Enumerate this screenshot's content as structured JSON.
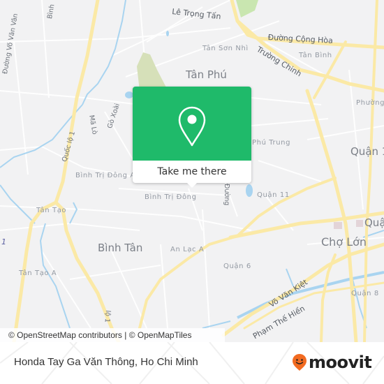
{
  "map": {
    "colors": {
      "background": "#f2f2f3",
      "major_road": "#fbe9a6",
      "water": "#a9d4f0",
      "park": "#d6e0b9",
      "green_area": "#c9e6b0",
      "building_block": "#e3d4d8"
    },
    "labels": {
      "districts": [
        {
          "id": "tan-phu",
          "text": "Tân Phú"
        },
        {
          "id": "binh-tan",
          "text": "Bình Tân"
        },
        {
          "id": "cho-lon",
          "text": "Chợ Lớn"
        },
        {
          "id": "quan-10-partial",
          "text": "Quận 1"
        },
        {
          "id": "quan-5-partial",
          "text": "Quận"
        }
      ],
      "wards": [
        {
          "id": "tan-son-nhi",
          "text": "Tân Sơn Nhì"
        },
        {
          "id": "tan-binh",
          "text": "Tân Bình"
        },
        {
          "id": "phuong-partial",
          "text": "Phường"
        },
        {
          "id": "phu-trung",
          "text": "Phú Trung"
        },
        {
          "id": "quan-11",
          "text": "Quận 11"
        },
        {
          "id": "binh-tri-dong-a",
          "text": "Bình Trị Đông A"
        },
        {
          "id": "binh-tri-dong",
          "text": "Bình Trị Đông"
        },
        {
          "id": "tan-tao",
          "text": "Tân Tạo"
        },
        {
          "id": "tan-tao-a",
          "text": "Tân Tạo A"
        },
        {
          "id": "an-lac-a",
          "text": "An Lạc A"
        },
        {
          "id": "quan-6",
          "text": "Quận 6"
        },
        {
          "id": "quan-8",
          "text": "Quận 8"
        }
      ],
      "streets": [
        {
          "id": "le-trong-tan",
          "text": "Lê Trọng Tấn"
        },
        {
          "id": "duong-cong-hoa",
          "text": "Đường Cộng Hòa"
        },
        {
          "id": "truong-chinh",
          "text": "Trường Chinh"
        },
        {
          "id": "quoc-lo-1",
          "text": "Quốc lộ 1"
        },
        {
          "id": "quoc-lo-1-south",
          "text": "lộ 1"
        },
        {
          "id": "ma-lo",
          "text": "Mã Lò"
        },
        {
          "id": "go-xoai",
          "text": "Gò Xoài"
        },
        {
          "id": "duong-vo-van-van",
          "text": "Đường Võ Văn Vân"
        },
        {
          "id": "binh-partial",
          "text": "Bình"
        },
        {
          "id": "duong-partial",
          "text": "Đường"
        },
        {
          "id": "vo-van-kiet",
          "text": "Võ Văn Kiệt"
        },
        {
          "id": "pham-the-hien",
          "text": "Phạm Thế Hiển"
        }
      ],
      "route_marker": "1"
    },
    "attribution": "© OpenStreetMap contributors | © OpenMapTiles"
  },
  "popup": {
    "icon": "map-pin-icon",
    "button_label": "Take me there",
    "accent": "#1fba6a"
  },
  "footer": {
    "place_name": "Honda Tay Ga Văn Thông, Ho Chi Minh",
    "brand": {
      "name": "moovit",
      "icon": "moovit-smiley-pin-icon",
      "accent": "#f26b21"
    }
  }
}
